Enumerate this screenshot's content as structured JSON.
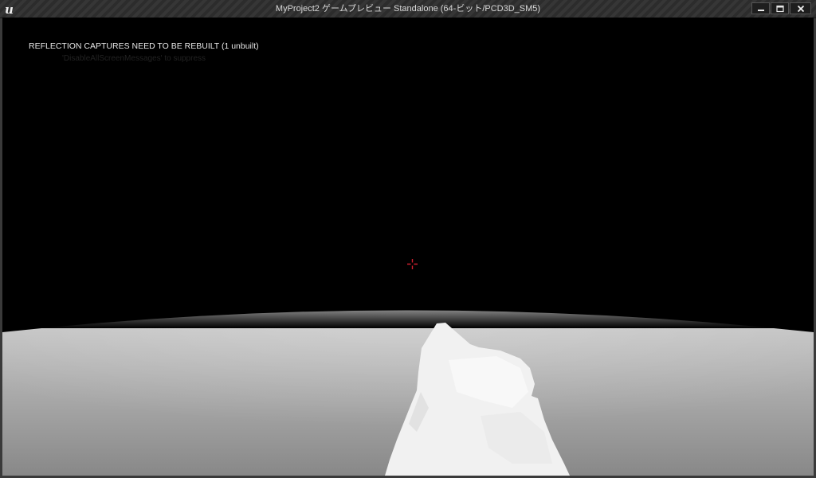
{
  "window": {
    "title": "MyProject2 ゲームプレビュー Standalone (64-ビット/PCD3D_SM5)",
    "controls": [
      {
        "name": "minimize-button",
        "icon": "minimize-icon"
      },
      {
        "name": "maximize-button",
        "icon": "maximize-icon"
      },
      {
        "name": "close-button",
        "icon": "close-icon"
      }
    ]
  },
  "viewport": {
    "warning_message": "REFLECTION CAPTURES NEED TO BE REBUILT (1 unbuilt)",
    "faint_message": "'DisableAllScreenMessages' to suppress",
    "crosshair_color": "#d0202e",
    "sky_color": "#000000",
    "floor_color_near": "#8e8e8e",
    "floor_color_far": "#c9c9c9",
    "weapon_color": "#f2f2f2"
  }
}
